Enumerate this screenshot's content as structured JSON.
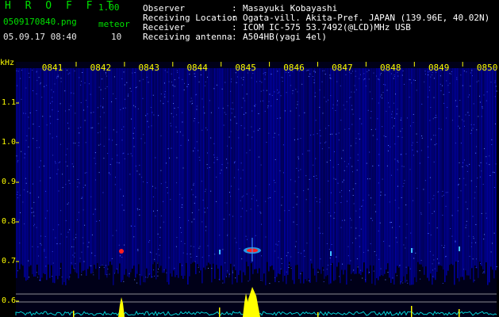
{
  "header": {
    "app_title": "H R O F F T",
    "app_version": "1.00",
    "file_name": "0509170840.png",
    "meteor_label": "meteor",
    "date_time": "05.09.17 08:40",
    "meteor_count": "10",
    "info": [
      {
        "key": "Observer",
        "value": "Masayuki Kobayashi"
      },
      {
        "key": "Receiving Location",
        "value": "Ogata-vill. Akita-Pref. JAPAN (139.96E, 40.02N)"
      },
      {
        "key": "Receiver",
        "value": "ICOM IC-575 53.7492(@LCD)MHz USB"
      },
      {
        "key": "Receiving antenna",
        "value": "A504HB(yagi 4el)"
      }
    ]
  },
  "spectrogram": {
    "y_unit": "kHz",
    "y_ticks": [
      "1.1",
      "1.0",
      "0.9",
      "0.8",
      "0.7",
      "0.6"
    ],
    "x_ticks": [
      "0841",
      "0842",
      "0843",
      "0844",
      "0845",
      "0846",
      "0847",
      "0848",
      "0849",
      "0850"
    ],
    "colors": {
      "text": "#ffff00",
      "noise": "#0000cc",
      "echo_core": "#ff2020",
      "baseline": "#00d0d0",
      "peak": "#ffff00"
    }
  }
}
